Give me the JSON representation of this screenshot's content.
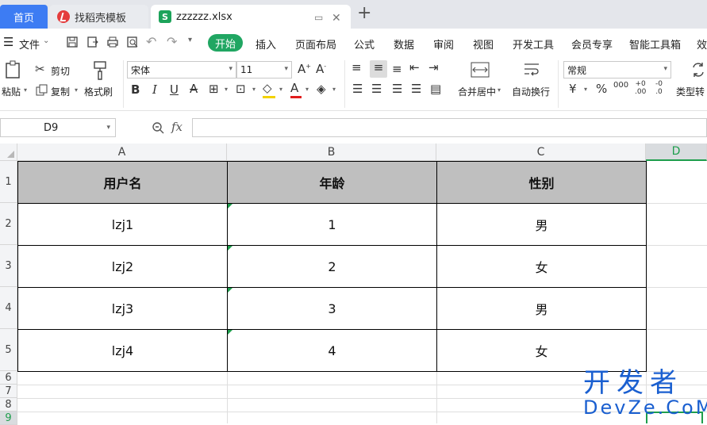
{
  "tabs": [
    {
      "label": "首页"
    },
    {
      "label": "找稻壳模板"
    },
    {
      "label": "zzzzzz.xlsx"
    }
  ],
  "menu": {
    "file": "文件",
    "items": [
      "开始",
      "插入",
      "页面布局",
      "公式",
      "数据",
      "审阅",
      "视图",
      "开发工具",
      "会员专享",
      "智能工具箱",
      "效"
    ]
  },
  "ribbon": {
    "paste": "粘贴",
    "cut": "剪切",
    "copy": "复制",
    "format_painter": "格式刷",
    "font_name": "宋体",
    "font_size": "11",
    "merge_center": "合并居中",
    "wrap_text": "自动换行",
    "number_format": "常规",
    "type_convert": "类型转"
  },
  "formula_bar": {
    "name_box": "D9",
    "fx": "fx",
    "formula": ""
  },
  "sheet": {
    "columns": [
      "A",
      "B",
      "C",
      "D"
    ],
    "rows": [
      "1",
      "2",
      "3",
      "4",
      "5",
      "6",
      "7",
      "8",
      "9"
    ],
    "headers": [
      "用户名",
      "年龄",
      "性别"
    ],
    "data": [
      [
        "lzj1",
        "1",
        "男"
      ],
      [
        "lzj2",
        "2",
        "女"
      ],
      [
        "lzj3",
        "3",
        "男"
      ],
      [
        "lzj4",
        "4",
        "女"
      ]
    ],
    "header_fill": "#bfbfbf",
    "selected_accent": "#1e9e4c"
  },
  "watermark": {
    "line1": "开发者",
    "line2": "DevZe.CoM"
  }
}
